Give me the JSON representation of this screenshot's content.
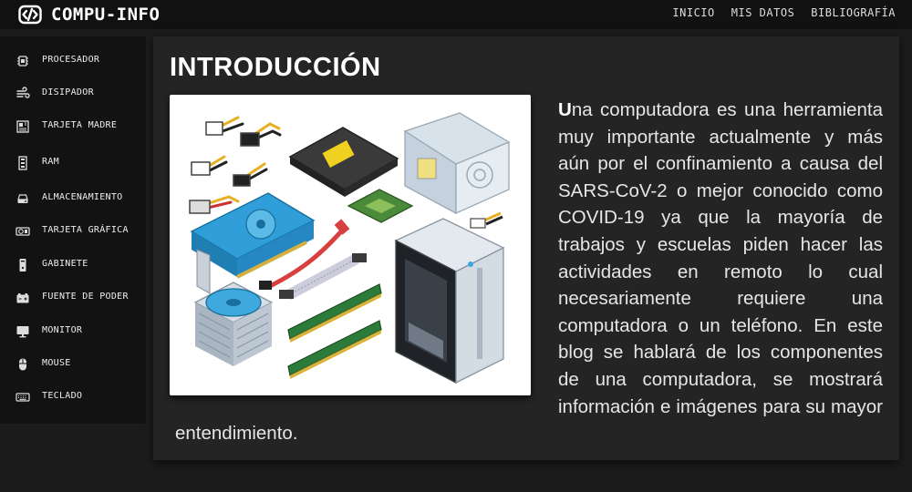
{
  "header": {
    "brand": "COMPU-INFO",
    "nav": [
      "INICIO",
      "MIS DATOS",
      "BIBLIOGRAFÍA"
    ]
  },
  "sidebar": {
    "items": [
      {
        "label": "PROCESADOR",
        "icon": "cpu-icon"
      },
      {
        "label": "DISIPADOR",
        "icon": "fan-icon"
      },
      {
        "label": "TARJETA MADRE",
        "icon": "motherboard-icon"
      },
      {
        "label": "RAM",
        "icon": "memory-icon"
      },
      {
        "label": "ALMACENAMIENTO",
        "icon": "hard-drive-icon"
      },
      {
        "label": "TARJETA GRÁFICA",
        "icon": "graphics-card-icon"
      },
      {
        "label": "GABINETE",
        "icon": "tower-icon"
      },
      {
        "label": "FUENTE DE PODER",
        "icon": "battery-icon"
      },
      {
        "label": "MONITOR",
        "icon": "monitor-icon"
      },
      {
        "label": "MOUSE",
        "icon": "mouse-icon"
      },
      {
        "label": "TECLADO",
        "icon": "keyboard-icon"
      }
    ]
  },
  "main": {
    "title": "INTRODUCCIÓN",
    "paragraph_first_letter": "U",
    "paragraph_rest": "na computadora es una herramienta muy importante actualmente y más aún por el confinamiento a causa del SARS-CoV-2 o mejor conocido como COVID-19 ya que la mayoría de trabajos y escuelas piden hacer las actividades en remoto lo cual necesariamente requiere una computadora o un teléfono. En este blog se hablará de los componentes de una computadora, se mostrará información e imágenes para su mayor entendimiento.",
    "image_alt": "computer-components-illustration"
  },
  "colors": {
    "page_bg": "#1c1c1c",
    "header_bg": "#111111",
    "sidebar_bg": "#121212",
    "card_bg": "#242424",
    "accent_blue": "#3aa9df"
  }
}
